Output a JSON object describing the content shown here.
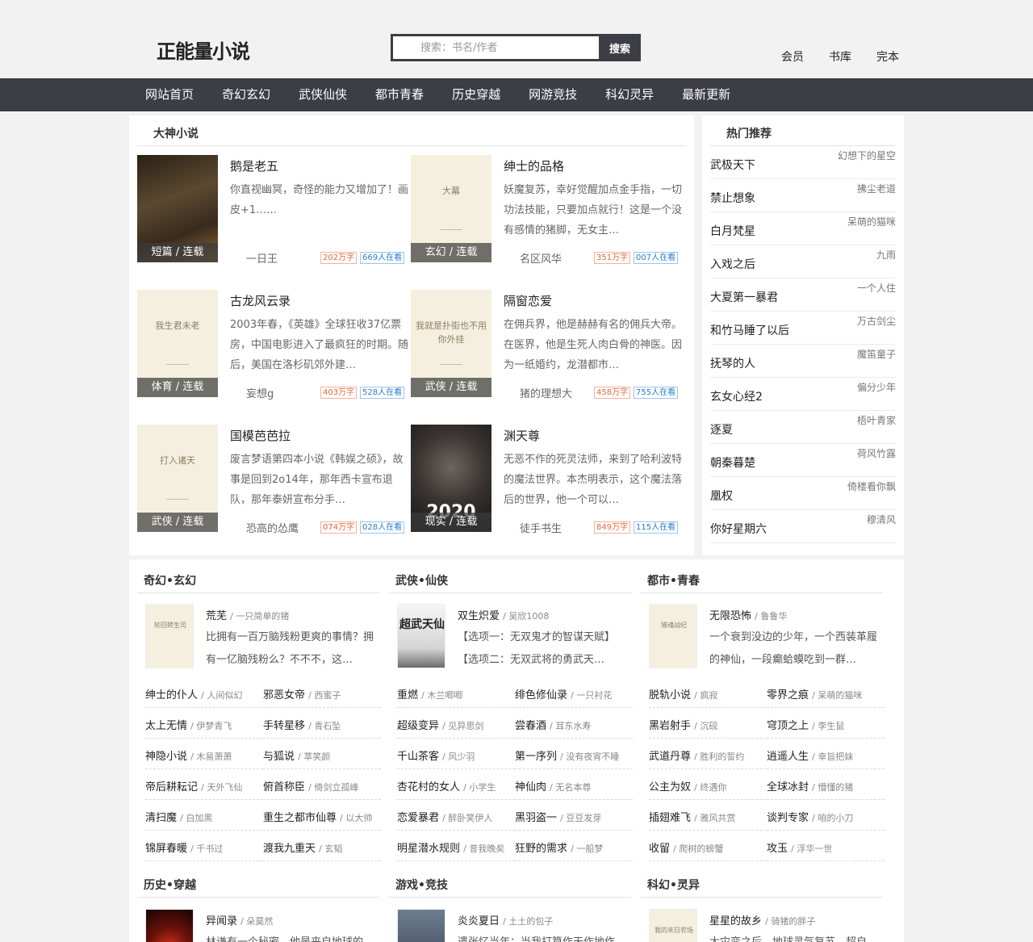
{
  "header": {
    "logo": "正能量小说",
    "search_placeholder": "搜索：书名/作者",
    "search_button": "搜索",
    "links": [
      "会员",
      "书库",
      "完本"
    ]
  },
  "nav": [
    "网站首页",
    "奇幻玄幻",
    "武侠仙侠",
    "都市青春",
    "历史穿越",
    "网游竞技",
    "科幻灵异",
    "最新更新"
  ],
  "featured": {
    "title": "大神小说",
    "books": [
      {
        "title": "鹅是老五",
        "desc": "你直视幽冥，奇怪的能力又增加了！画皮+1……",
        "author": "一日王",
        "words": "202万字",
        "readers": "669人在看",
        "tag": "短篇 / 连载",
        "cover_text": ""
      },
      {
        "title": "绅士的品格",
        "desc": "妖魔复苏，幸好觉醒加点金手指，一切功法技能，只要加点就行！这是一个没有感情的猪脚，无女主…",
        "author": "名区风华",
        "words": "351万字",
        "readers": "007人在看",
        "tag": "玄幻 / 连载",
        "cover_text": "大幕"
      },
      {
        "title": "古龙风云录",
        "desc": "2003年春，《英雄》全球狂收37亿票房，中国电影进入了最疯狂的时期。随后，美国在洛杉矶郊外建…",
        "author": "妄想g",
        "words": "403万字",
        "readers": "528人在看",
        "tag": "体育 / 连载",
        "cover_text": "我生君未老"
      },
      {
        "title": "隔窗恋爱",
        "desc": "在佣兵界，他是赫赫有名的佣兵大帝。在医界，他是生死人肉白骨的神医。因为一纸婚约，龙潜都市…",
        "author": "猪的理想大",
        "words": "458万字",
        "readers": "755人在看",
        "tag": "武侠 / 连载",
        "cover_text": "我就是扑街也不用你外挂"
      },
      {
        "title": "国模芭芭拉",
        "desc": "废言梦语第四本小说《韩娱之硕》，故事是回到2o14年，那年西卡宣布退队，那年泰妍宣布分手…",
        "author": "恐高的怂鹰",
        "words": "074万字",
        "readers": "028人在看",
        "tag": "武侠 / 连载",
        "cover_text": "打入诸天"
      },
      {
        "title": "渊天尊",
        "desc": "无恶不作的死灵法师，来到了哈利波特的魔法世界。本杰明表示，这个魔法落后的世界，他一个可以…",
        "author": "徒手书生",
        "words": "849万字",
        "readers": "115人在看",
        "tag": "现实 / 连载",
        "cover_text": "2020"
      }
    ]
  },
  "hot": {
    "title": "热门推荐",
    "items": [
      {
        "title": "武极天下",
        "author": "幻想下的星空"
      },
      {
        "title": "禁止想象",
        "author": "拂尘老道"
      },
      {
        "title": "白月梵星",
        "author": "呆萌的猫咪"
      },
      {
        "title": "入戏之后",
        "author": "九雨"
      },
      {
        "title": "大夏第一暴君",
        "author": "一个人住"
      },
      {
        "title": "和竹马睡了以后",
        "author": "万古剑尘"
      },
      {
        "title": "抚琴的人",
        "author": "魔笛童子"
      },
      {
        "title": "玄女心经2",
        "author": "偏分少年"
      },
      {
        "title": "逐夏",
        "author": "梧叶青家"
      },
      {
        "title": "朝秦暮楚",
        "author": "荷风竹露"
      },
      {
        "title": "凰权",
        "author": "倚楼看你飘"
      },
      {
        "title": "你好星期六",
        "author": "穆清风"
      }
    ]
  },
  "categories": [
    {
      "title": "奇幻•玄幻",
      "feature": {
        "title": "荒芜",
        "author": "/ 一只简单的猪",
        "desc": "比拥有一百万脑残粉更爽的事情？拥有一亿脑残粉么？不不不，这…",
        "cover_text": "轮回转生司"
      },
      "list": [
        {
          "t": "绅士的仆人",
          "a": "/ 人间似幻"
        },
        {
          "t": "邪恶女帝",
          "a": "/ 西蜜子"
        },
        {
          "t": "太上无情",
          "a": "/ 伊梦青飞"
        },
        {
          "t": "手转星移",
          "a": "/ 青石坠"
        },
        {
          "t": "神隐小说",
          "a": "/ 木易萧萧"
        },
        {
          "t": "与狐说",
          "a": "/ 萃笑颜"
        },
        {
          "t": "帝后耕耘记",
          "a": "/ 天外飞仙"
        },
        {
          "t": "俯首称臣",
          "a": "/ 倚剑立孤峰"
        },
        {
          "t": "清扫魔",
          "a": "/ 白加黑"
        },
        {
          "t": "重生之都市仙尊",
          "a": "/ 以大帅"
        },
        {
          "t": "锦屏春暖",
          "a": "/ 千书过"
        },
        {
          "t": "渡我九重天",
          "a": "/ 玄韬"
        }
      ]
    },
    {
      "title": "武侠•仙侠",
      "feature": {
        "title": "双生炽爱",
        "author": "/ 吴欣1008",
        "desc": "【选项一：无双鬼才的智谋天赋】【选项二：无双武将的勇武天…",
        "cover_text": "超武天仙"
      },
      "list": [
        {
          "t": "重燃",
          "a": "/ 木兰唧唧"
        },
        {
          "t": "绯色修仙录",
          "a": "/ 一只衬花"
        },
        {
          "t": "超级变异",
          "a": "/ 见异思剑"
        },
        {
          "t": "尝春酒",
          "a": "/ 耳东水寿"
        },
        {
          "t": "千山茶客",
          "a": "/ 风少羽"
        },
        {
          "t": "第一序列",
          "a": "/ 没有夜宵不睡"
        },
        {
          "t": "杏花村的女人",
          "a": "/ 小学生"
        },
        {
          "t": "神仙肉",
          "a": "/ 无名本尊"
        },
        {
          "t": "恋爱暴君",
          "a": "/ 醉卧笑伊人"
        },
        {
          "t": "黑羽盗一",
          "a": "/ 豆豆发芽"
        },
        {
          "t": "明星潜水规则",
          "a": "/ 昔我晚矣"
        },
        {
          "t": "狂野的需求",
          "a": "/ 一船梦"
        }
      ]
    },
    {
      "title": "都市•青春",
      "feature": {
        "title": "无限恐怖",
        "author": "/ 鲁鲁华",
        "desc": "一个衰到没边的少年，一个西装革履的神仙，一段癫蛤蟆吃到一群…",
        "cover_text": "猎魂战纪"
      },
      "list": [
        {
          "t": "脱轨小说",
          "a": "/ 疯寂"
        },
        {
          "t": "零界之痕",
          "a": "/ 呆萌的猫咪"
        },
        {
          "t": "黑岩射手",
          "a": "/ 沉砚"
        },
        {
          "t": "穹顶之上",
          "a": "/ 李生鼠"
        },
        {
          "t": "武道丹尊",
          "a": "/ 胜利的誓约"
        },
        {
          "t": "逍遥人生",
          "a": "/ 幸旨把妹"
        },
        {
          "t": "公主为奴",
          "a": "/ 终遇你"
        },
        {
          "t": "全球冰封",
          "a": "/ 懵懂的猪"
        },
        {
          "t": "插翅难飞",
          "a": "/ 雅风共赏"
        },
        {
          "t": "谈判专家",
          "a": "/ 咱的小刀"
        },
        {
          "t": "收留",
          "a": "/ 爬树的螃蟹"
        },
        {
          "t": "攻玉",
          "a": "/ 浮华一世"
        }
      ]
    },
    {
      "title": "历史•穿越",
      "feature": {
        "title": "异闻录",
        "author": "/ 朵莫然",
        "desc": "林谦有一个秘密，他是来自地球的",
        "cover_text": ""
      }
    },
    {
      "title": "游戏•竞技",
      "feature": {
        "title": "炎炎夏日",
        "author": "/ 土土的包子",
        "desc": "遗张忆当年：当我打算作天作地作",
        "cover_text": ""
      }
    },
    {
      "title": "科幻•灵异",
      "feature": {
        "title": "星星的故乡",
        "author": "/ 骑猪的胖子",
        "desc": "大灾变之后，地球灵气复苏，超自",
        "cover_text": "我的末日农场"
      }
    }
  ]
}
